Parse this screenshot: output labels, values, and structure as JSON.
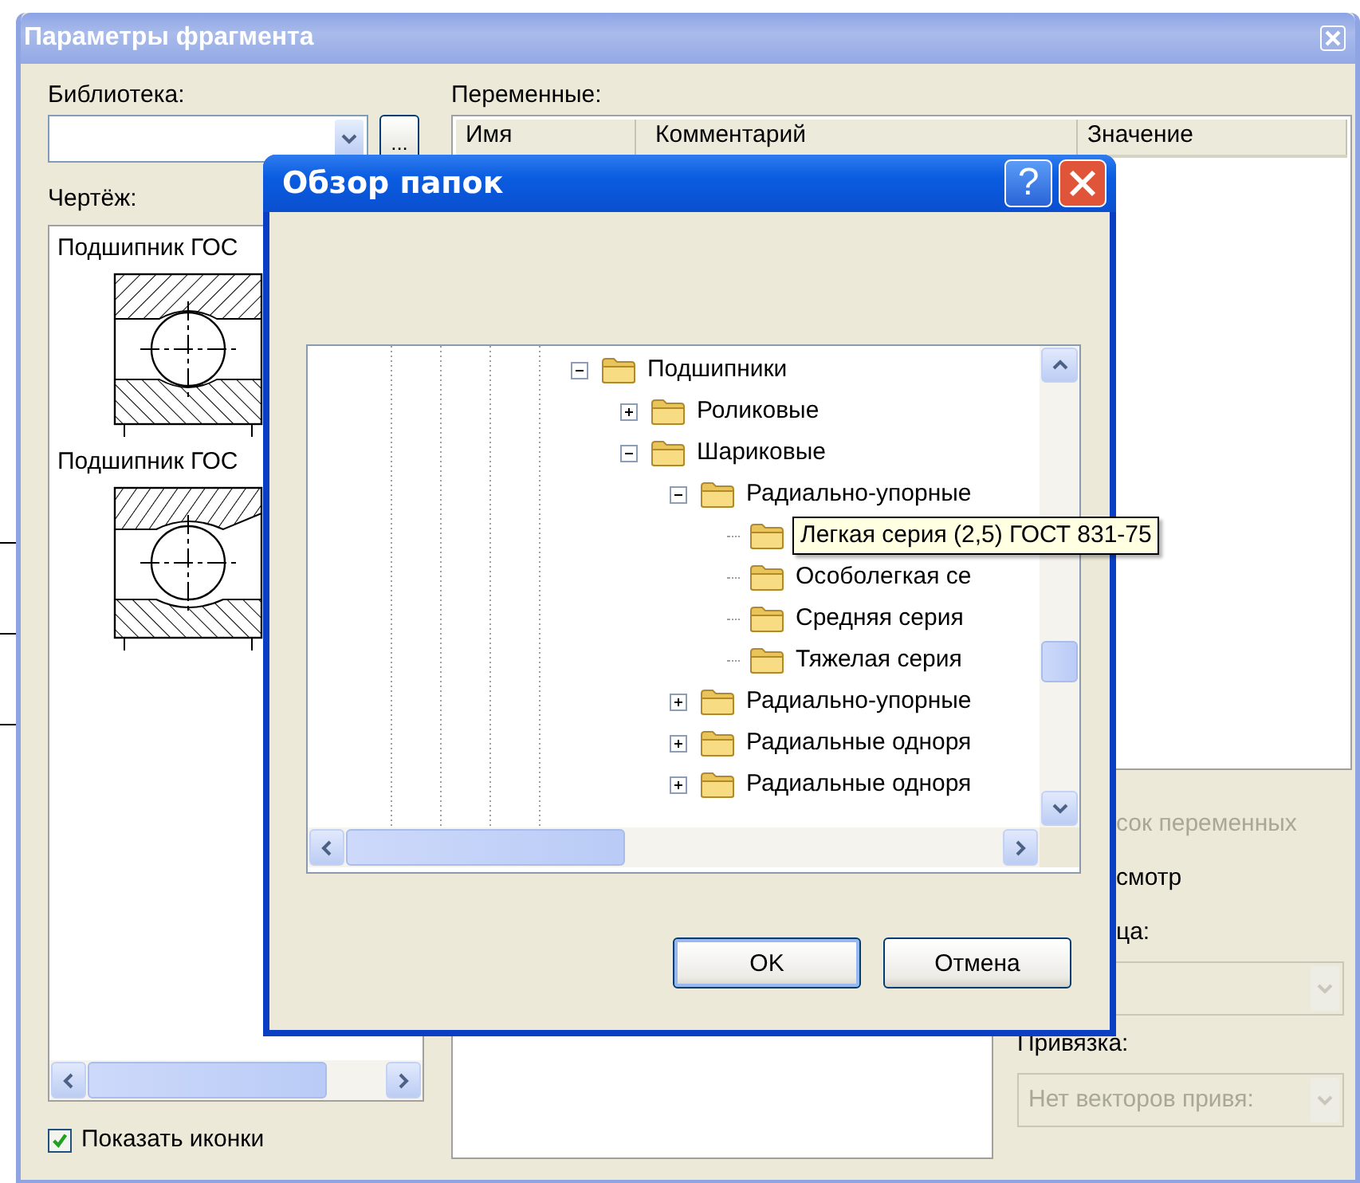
{
  "main_window": {
    "title": "Параметры фрагмента",
    "library": {
      "label": "Библиотека:",
      "browse_button": "..."
    },
    "drawing": {
      "label": "Чертёж:",
      "items": [
        {
          "label": "Подшипник ГОС",
          "kind": "radial"
        },
        {
          "label": "Подшипник ГОС",
          "kind": "angular"
        }
      ]
    },
    "show_icons": {
      "label": "Показать иконки",
      "checked": true
    },
    "variables": {
      "label": "Переменные:",
      "columns": [
        "Имя",
        "Комментарий",
        "Значение"
      ]
    },
    "options": [
      {
        "label": "сок переменных",
        "disabled": true
      },
      {
        "label": "смотр",
        "disabled": false
      },
      {
        "label": "ца:",
        "disabled": false
      }
    ],
    "unit_combo": {
      "disabled": true
    },
    "binding": {
      "label": "Привязка:",
      "value": "Нет векторов привя:",
      "disabled": true
    }
  },
  "dialog": {
    "title": "Обзор папок",
    "help_button": "?",
    "tree": [
      {
        "label": "Подшипники",
        "expanded": true,
        "children": [
          {
            "label": "Роликовые",
            "expanded": false
          },
          {
            "label": "Шариковые",
            "expanded": true,
            "children": [
              {
                "label": "Радиально-упорные",
                "expanded": true,
                "children": [
                  {
                    "label": "Легкая серия (2,5) ГОСТ 831-75",
                    "hovered": true
                  },
                  {
                    "label": "Особолегкая се",
                    "hovered": false
                  },
                  {
                    "label": "Средняя серия",
                    "hovered": false
                  },
                  {
                    "label": "Тяжелая серия",
                    "hovered": false
                  }
                ]
              },
              {
                "label": "Радиально-упорные",
                "expanded": false
              },
              {
                "label": "Радиальные одноря",
                "expanded": false
              },
              {
                "label": "Радиальные одноря",
                "expanded": false
              }
            ]
          }
        ]
      }
    ],
    "buttons": [
      {
        "label": "OK",
        "default": true
      },
      {
        "label": "Отмена",
        "default": false
      }
    ]
  }
}
